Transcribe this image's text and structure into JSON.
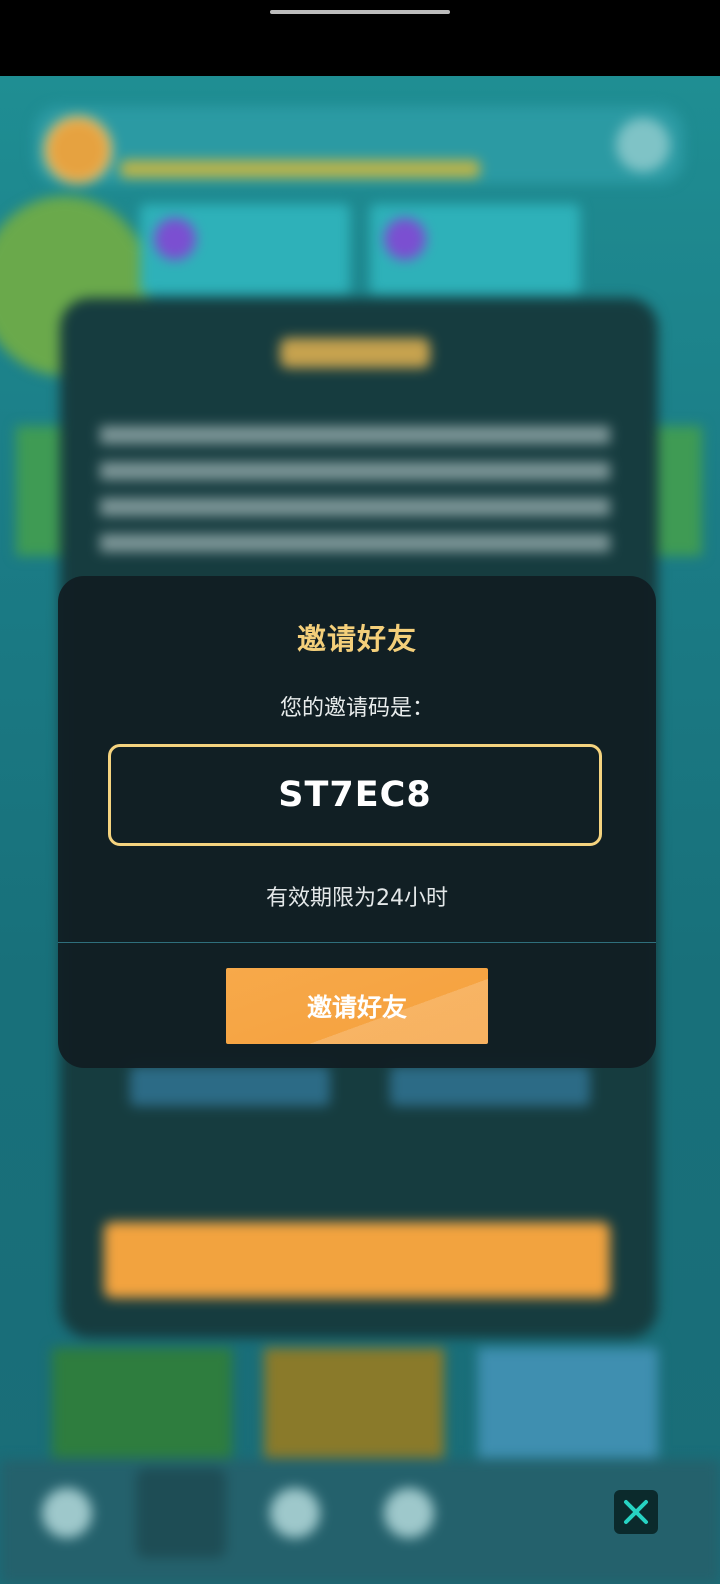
{
  "dialog": {
    "title": "邀请好友",
    "code_label": "您的邀请码是：",
    "invite_code": "ST7EC8",
    "validity_text": "有效期限为24小时",
    "invite_button_label": "邀请好友"
  },
  "colors": {
    "title": "#f4cf7a",
    "code_border": "#f5d37f",
    "button": "#f5a03d",
    "dialog_bg": "#111e23",
    "close_icon": "#27d3c3"
  },
  "icons": {
    "close": "close-icon"
  }
}
